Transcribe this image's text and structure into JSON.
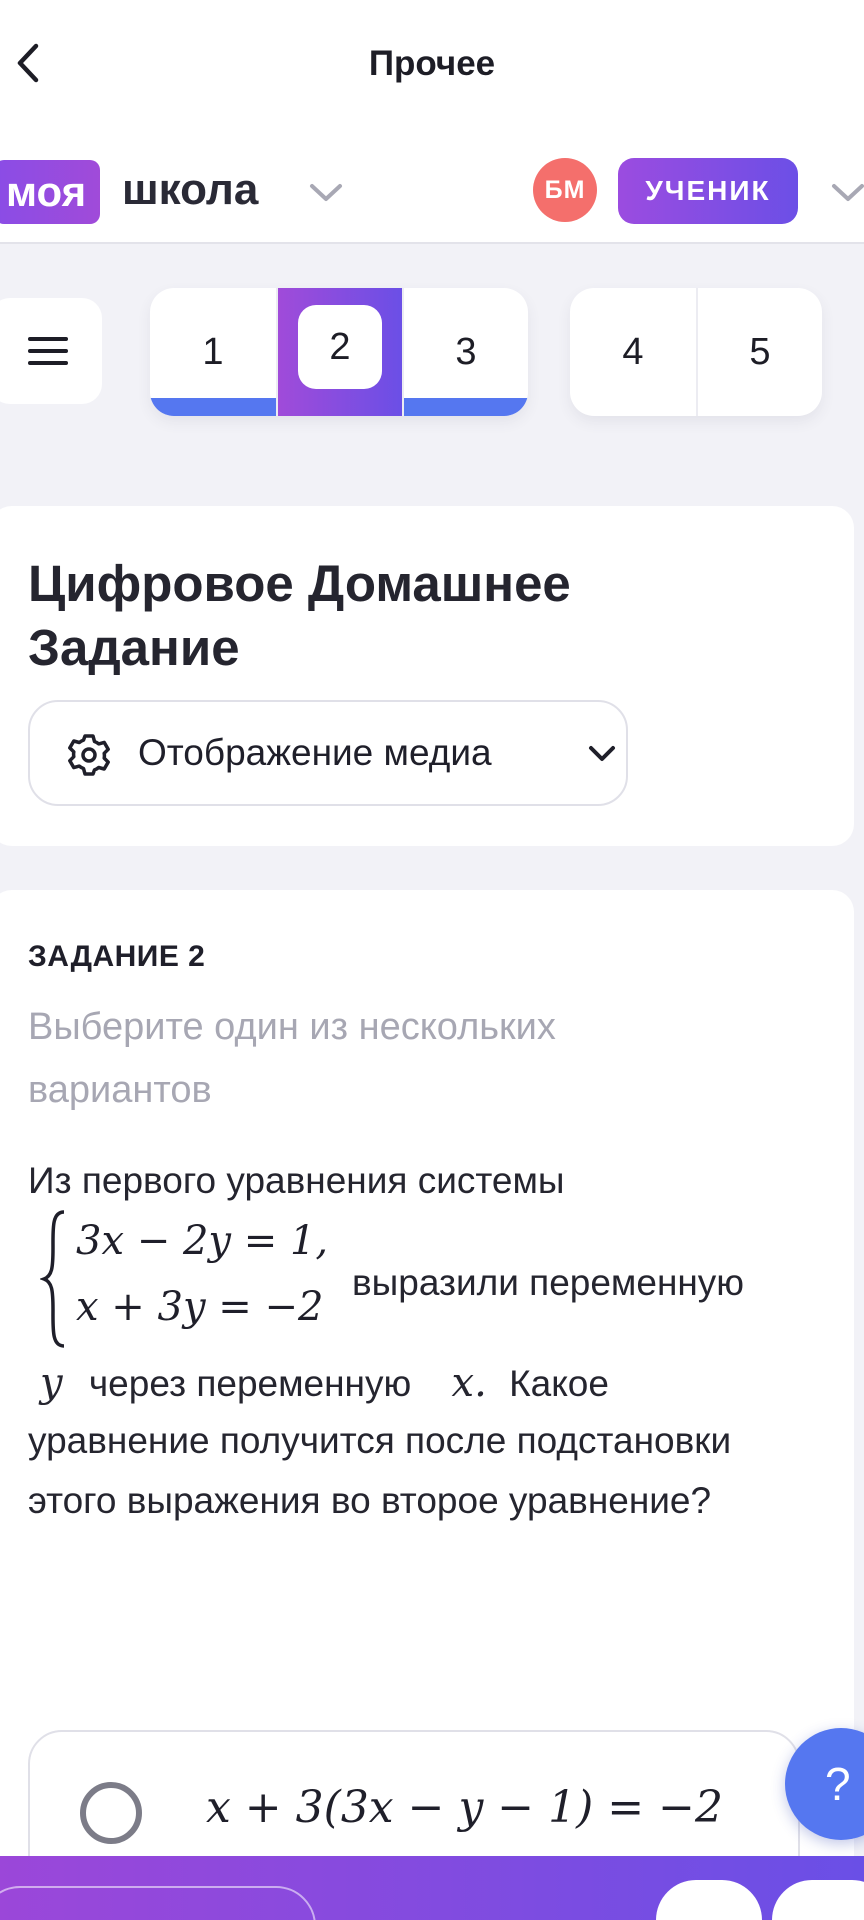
{
  "nav": {
    "title": "Прочее"
  },
  "brand": {
    "logo_part1": "моя",
    "logo_part2": "школа",
    "avatar_initials": "БМ",
    "role": "УЧЕНИК"
  },
  "tasks": {
    "group1": [
      {
        "label": "1",
        "status": "done"
      },
      {
        "label": "2",
        "status": "active"
      },
      {
        "label": "3",
        "status": "done"
      }
    ],
    "group2": [
      {
        "label": "4",
        "status": "pending"
      },
      {
        "label": "5",
        "status": "pending"
      }
    ]
  },
  "header_card": {
    "title": "Цифровое Домашнее Задание",
    "media_dropdown_label": "Отображение медиа"
  },
  "task": {
    "label": "ЗАДАНИЕ 2",
    "hint": "Выберите один из нескольких вариантов",
    "question_intro": "Из первого уравнения системы",
    "system_eq1": "3x − 2y = 1,",
    "system_eq2": "x + 3y = −2",
    "question_mid": "выразили переменную",
    "var_y": "y",
    "question_via": "через переменную",
    "var_x": "x.",
    "question_rest1": "Какое",
    "question_rest2": "уравнение получится после подстановки",
    "question_rest3": "этого выражения во второе уравнение?",
    "answers": [
      {
        "text": "x + 3(3x − y − 1) = −2",
        "selected": false
      }
    ]
  },
  "help": {
    "label": "?"
  },
  "colors": {
    "accent_purple": "#8a4ce6",
    "accent_blue": "#5577f0",
    "avatar_red": "#f46f6c",
    "background": "#f2f2f7"
  }
}
